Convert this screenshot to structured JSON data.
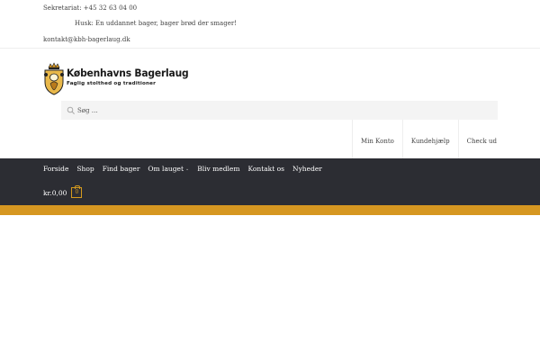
{
  "topbar": {
    "phone": "Sekretariat: +45 32 63 04 00",
    "slogan": "Husk: En uddannet bager, bager brød der smager!",
    "email": "kontakt@kbh-bagerlaug.dk"
  },
  "logo": {
    "name": "Københavns Bagerlaug",
    "tagline": "Faglig stolthed og traditioner"
  },
  "search": {
    "placeholder": "Søg …"
  },
  "secondary_nav": {
    "items": [
      "Min Konto",
      "Kundehjælp",
      "Check ud"
    ]
  },
  "main_nav": {
    "items": [
      "Forside",
      "Shop",
      "Find bager",
      "Om lauget",
      "Bliv medlem",
      "Kontakt os",
      "Nyheder"
    ],
    "dropdown_caret": "⌄"
  },
  "cart": {
    "amount": "kr.0,00",
    "count": "0"
  },
  "colors": {
    "nav_bg": "#2c2d33",
    "accent": "#d69721",
    "search_bg": "#f4f4f4"
  }
}
